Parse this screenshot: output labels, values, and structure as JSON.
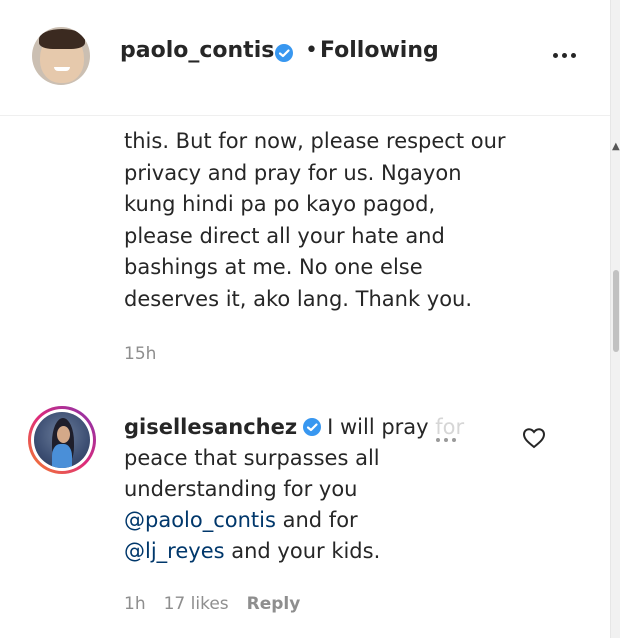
{
  "header": {
    "username": "paolo_contis",
    "separator": "•",
    "following_label": "Following"
  },
  "caption": {
    "lines": [
      "this. But for now, please respect our",
      "privacy and pray for us. Ngayon",
      "kung hindi pa po kayo pagod,",
      "please direct all your hate and",
      "bashings at me. No one else",
      "deserves it, ako lang. Thank you."
    ],
    "time": "15h"
  },
  "comment": {
    "username": "gisellesanchez",
    "line1_text": "I will pray",
    "line1_faded": " for",
    "line2": "peace that surpasses all",
    "line3": "understanding for you",
    "mention1": "@paolo_contis",
    "line4_rest": " and for",
    "mention2": "@lj_reyes",
    "line5_rest": " and your kids.",
    "time": "1h",
    "likes": "17 likes",
    "reply_label": "Reply"
  },
  "colors": {
    "text": "#262626",
    "secondary": "#8e8e8e",
    "verified": "#3897f0",
    "mention": "#00376b"
  },
  "icons": {
    "more": "more-horizontal-icon",
    "verified": "verified-badge-icon",
    "heart": "heart-outline-icon"
  }
}
